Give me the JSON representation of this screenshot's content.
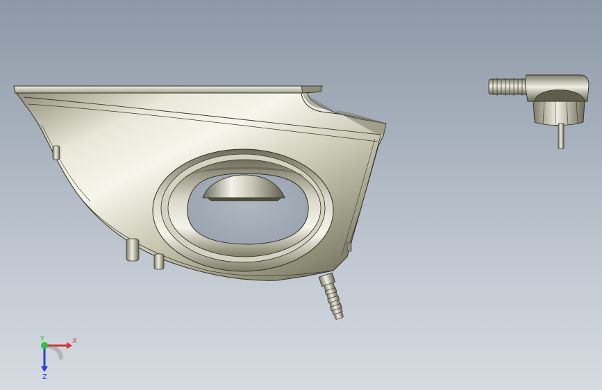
{
  "viewport": {
    "background_top": "#8d98a6",
    "background_bottom": "#d6dbe1"
  },
  "model": {
    "parts": [
      "iron-body",
      "handle-opening",
      "cord-strain-relief",
      "power-plug"
    ],
    "body_color": "#c9c8b4",
    "edge_color": "#2e2e26"
  },
  "triad": {
    "x_label": "X",
    "y_label": "Y",
    "z_label": "Z",
    "x_color": "#e03030",
    "y_color": "#2fbf3a",
    "z_color": "#2d3fd6"
  }
}
